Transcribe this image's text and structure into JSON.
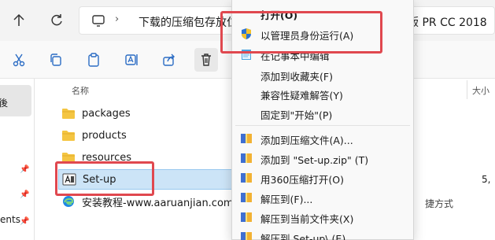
{
  "address_bar": {
    "path_left": "下载的压缩包存放位",
    "path_right": "版 PR CC 2018"
  },
  "columns": {
    "name": "名称",
    "size": "大小"
  },
  "sidebar": {
    "item_partial": "後",
    "bottom_partial": "ents"
  },
  "files": [
    {
      "name": "packages",
      "type": "folder"
    },
    {
      "name": "products",
      "type": "folder"
    },
    {
      "name": "resources",
      "type": "folder"
    },
    {
      "name": "Set-up",
      "type": "app",
      "size": "5,",
      "selected": true
    },
    {
      "name": "安装教程-www.aaruanjian.com",
      "type": "shortcut",
      "type_label": "捷方式"
    }
  ],
  "context_menu": {
    "title": "打开(O)",
    "items": [
      {
        "label": "以管理员身份运行(A)",
        "icon": "shield-icon"
      },
      {
        "label": "在记事本中编辑",
        "icon": "notepad-icon"
      },
      {
        "label": "添加到收藏夹(F)",
        "icon": ""
      },
      {
        "label": "兼容性疑难解答(Y)",
        "icon": ""
      },
      {
        "label": "固定到\"开始\"(P)",
        "icon": ""
      },
      {
        "label": "添加到压缩文件(A)...",
        "icon": "archive-icon"
      },
      {
        "label": "添加到 \"Set-up.zip\" (T)",
        "icon": "archive-icon"
      },
      {
        "label": "用360压缩打开(O)",
        "icon": "archive-icon"
      },
      {
        "label": "解压到(F)...",
        "icon": "archive-icon"
      },
      {
        "label": "解压到当前文件夹(X)",
        "icon": "archive-icon"
      },
      {
        "label": "解压到 Set-up\\ (E)",
        "icon": "archive-icon"
      }
    ]
  },
  "colors": {
    "highlight": "#e0484f",
    "folder": "#f4c542",
    "selection": "#cce4f7"
  }
}
